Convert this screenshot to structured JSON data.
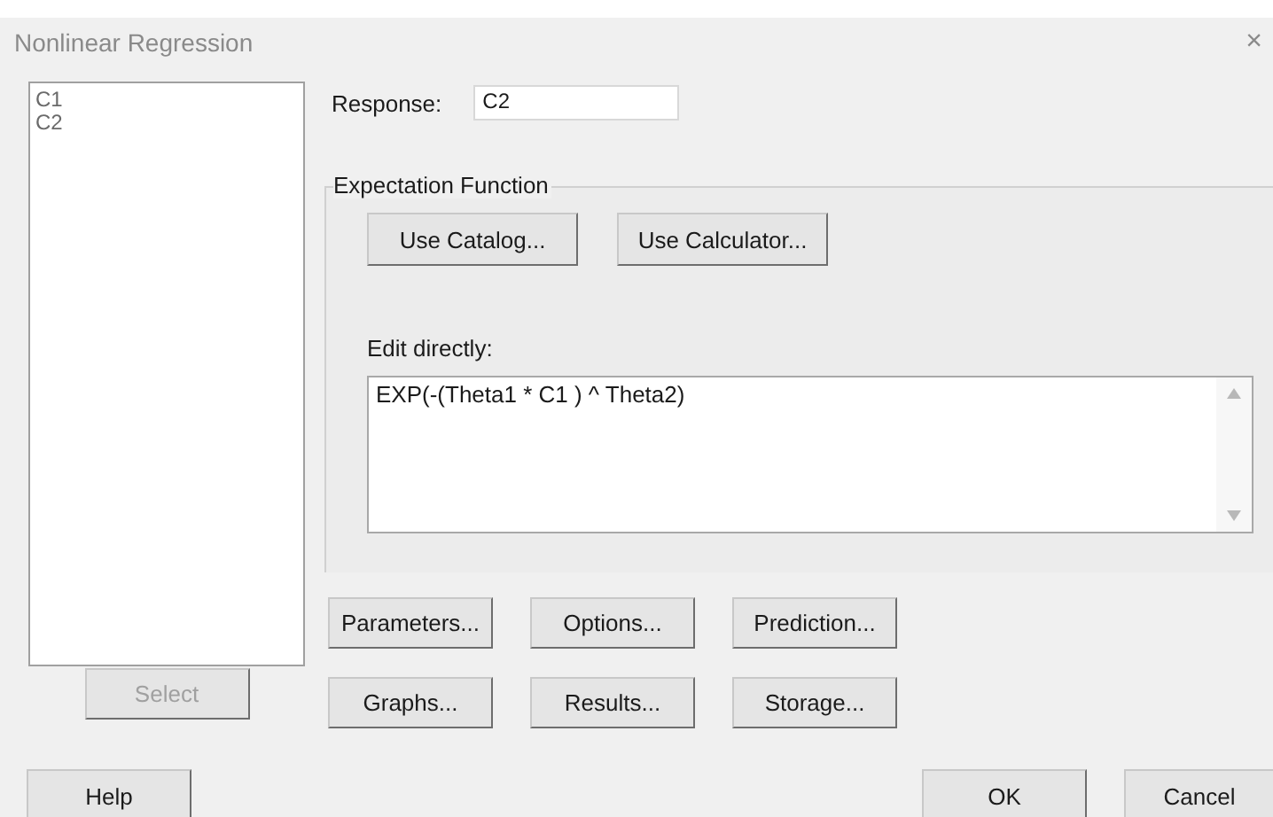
{
  "window": {
    "title": "Nonlinear Regression",
    "close": "×"
  },
  "variables": {
    "items": [
      {
        "label": "C1",
        "selected": false
      },
      {
        "label": "C2",
        "selected": false
      }
    ],
    "select_button": {
      "label": "Select",
      "disabled": true
    }
  },
  "response": {
    "label": "Response:",
    "value": "C2"
  },
  "expectation_function": {
    "title": "Expectation Function",
    "buttons": [
      {
        "label": "Use Catalog..."
      },
      {
        "label": "Use Calculator..."
      }
    ],
    "edit_label": {
      "label": "Edit directly:"
    },
    "expression": "EXP(-(Theta1 * C1 ) ^ Theta2)"
  },
  "option_buttons": [
    [
      {
        "label": "Parameters..."
      },
      {
        "label": "Options..."
      },
      {
        "label": "Prediction..."
      }
    ],
    [
      {
        "label": "Graphs..."
      },
      {
        "label": "Results..."
      },
      {
        "label": "Storage..."
      }
    ]
  ],
  "footer": {
    "help": {
      "label": "Help"
    },
    "ok": {
      "label": "OK"
    },
    "cancel": {
      "label": "Cancel"
    }
  }
}
